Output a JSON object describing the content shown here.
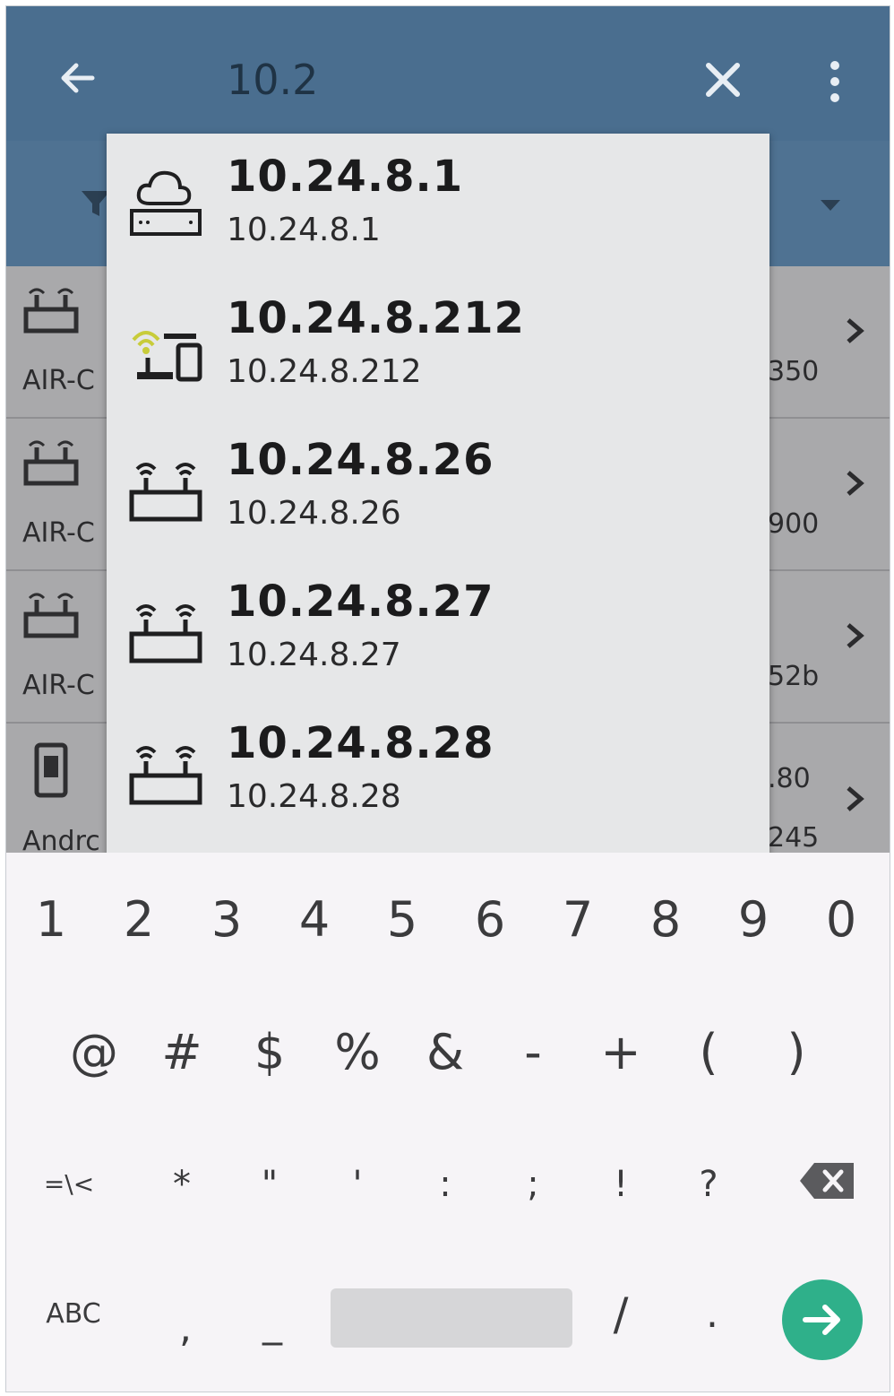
{
  "app_bar": {
    "back_icon": "arrow-left-icon",
    "query": "10.2",
    "clear_icon": "close-icon",
    "more_icon": "more-vert-icon"
  },
  "background_list": {
    "rows": [
      {
        "subtitle": "AIR-C",
        "right_value": "350"
      },
      {
        "subtitle": "AIR-C",
        "right_value": "900"
      },
      {
        "subtitle": "AIR-C",
        "right_value": "52b"
      },
      {
        "subtitle": "Andrc",
        "right_value": ".80",
        "right_value_2": "245"
      }
    ]
  },
  "suggestions": [
    {
      "title": "10.24.8.1",
      "subtitle": "10.24.8.1",
      "icon": "cloud-router-icon"
    },
    {
      "title": "10.24.8.212",
      "subtitle": "10.24.8.212",
      "icon": "wifi-device-icon"
    },
    {
      "title": "10.24.8.26",
      "subtitle": "10.24.8.26",
      "icon": "access-point-icon"
    },
    {
      "title": "10.24.8.27",
      "subtitle": "10.24.8.27",
      "icon": "access-point-icon"
    },
    {
      "title": "10.24.8.28",
      "subtitle": "10.24.8.28",
      "icon": "access-point-icon"
    }
  ],
  "keyboard": {
    "row1": [
      "1",
      "2",
      "3",
      "4",
      "5",
      "6",
      "7",
      "8",
      "9",
      "0"
    ],
    "row2": [
      "@",
      "#",
      "$",
      "%",
      "&",
      "-",
      "+",
      "(",
      ")"
    ],
    "row3": [
      "=\\<",
      "*",
      "\"",
      "'",
      ":",
      ";",
      "!",
      "?"
    ],
    "row4": {
      "abc": "ABC",
      "comma": ",",
      "underscore": "_",
      "slash": "/",
      "period": "."
    },
    "enter_icon": "arrow-right-icon",
    "backspace_icon": "backspace-icon",
    "accent": "#2fb08a"
  },
  "colors": {
    "app_bar": "#4a6e8f",
    "popup": "#e6e7e8"
  }
}
